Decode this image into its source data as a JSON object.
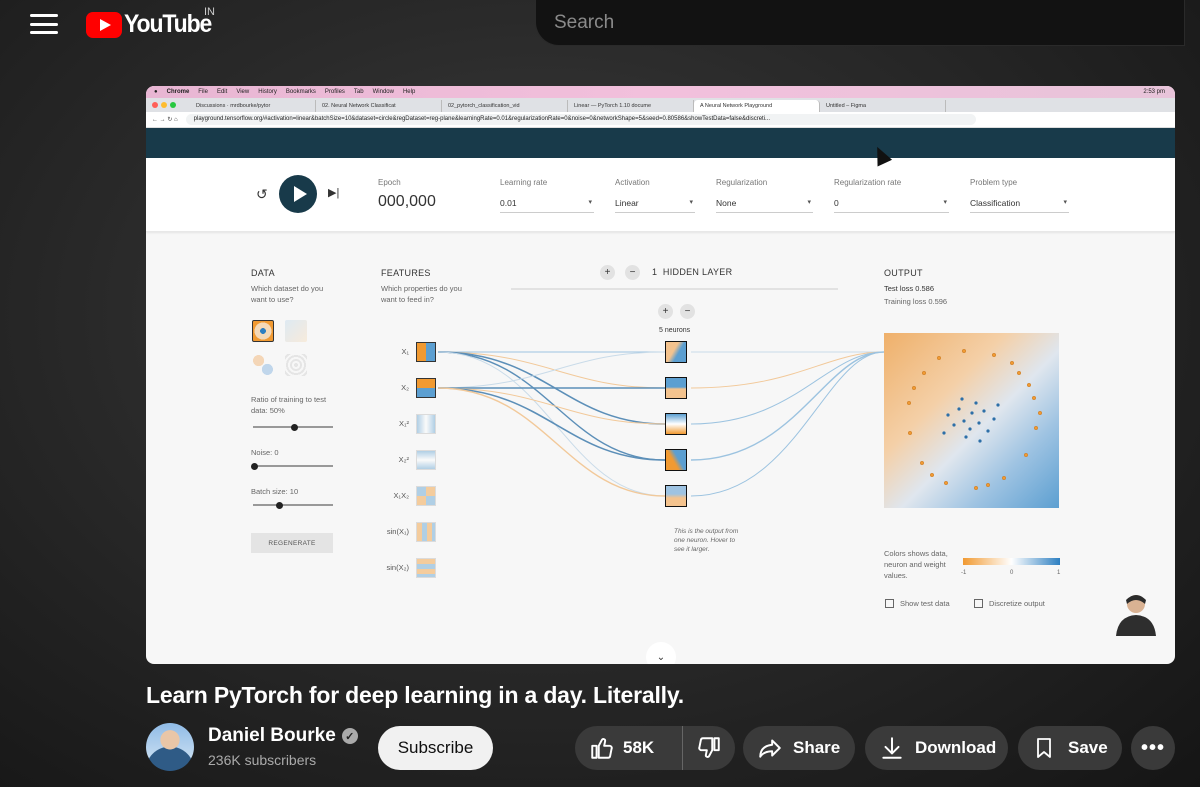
{
  "youtube": {
    "logo_text": "YouTube",
    "country": "IN",
    "search_placeholder": "Search"
  },
  "video_frame": {
    "mac_menu": [
      "Chrome",
      "File",
      "Edit",
      "View",
      "History",
      "Bookmarks",
      "Profiles",
      "Tab",
      "Window",
      "Help"
    ],
    "mac_clock": "2:53 pm",
    "tabs": [
      "Discussions · mrdbourke/pytor",
      "02. Neural Network Classificat",
      "02_pytorch_classification_vid",
      "Linear — PyTorch 1.10 docume",
      "A Neural Network Playground",
      "Untitled – Figma"
    ],
    "url": "playground.tensorflow.org/#activation=linear&batchSize=10&dataset=circle&regDataset=reg-plane&learningRate=0.01&regularizationRate=0&noise=0&networkShape=5&seed=0.80586&showTestData=false&discreti...",
    "epoch_label": "Epoch",
    "epoch_value": "000,000",
    "learning_rate_label": "Learning rate",
    "learning_rate_value": "0.01",
    "activation_label": "Activation",
    "activation_value": "Linear",
    "regularization_label": "Regularization",
    "regularization_value": "None",
    "reg_rate_label": "Regularization rate",
    "reg_rate_value": "0",
    "problem_type_label": "Problem type",
    "problem_type_value": "Classification",
    "data_heading": "DATA",
    "data_sub": "Which dataset do you want to use?",
    "ratio_label": "Ratio of training to test data:  50%",
    "noise_label": "Noise:  0",
    "batch_label": "Batch size:  10",
    "regenerate": "REGENERATE",
    "features_heading": "FEATURES",
    "features_sub": "Which properties do you want to feed in?",
    "feature_labels": [
      "X₁",
      "X₂",
      "X₁²",
      "X₂²",
      "X₁X₂",
      "sin(X₁)",
      "sin(X₂)"
    ],
    "hidden_count": "1",
    "hidden_label": "HIDDEN LAYER",
    "neurons_label": "5 neurons",
    "neuron_note": "This is the output from one neuron. Hover to see it larger.",
    "output_heading": "OUTPUT",
    "test_loss": "Test loss 0.586",
    "training_loss": "Training loss 0.596",
    "colors_note": "Colors shows data, neuron and weight values.",
    "colorbar_ticks": [
      "-1",
      "0",
      "1"
    ],
    "show_test_data": "Show test data",
    "discretize_output": "Discretize output"
  },
  "video": {
    "title": "Learn PyTorch for deep learning in a day. Literally.",
    "channel": "Daniel Bourke",
    "subscribers": "236K subscribers",
    "subscribe_label": "Subscribe",
    "likes": "58K",
    "share_label": "Share",
    "download_label": "Download",
    "save_label": "Save"
  },
  "colors": {
    "yt_red": "#ff0000",
    "playground_dark": "#183a4a",
    "orange": "#f19a32",
    "blue": "#2d7fc1"
  }
}
